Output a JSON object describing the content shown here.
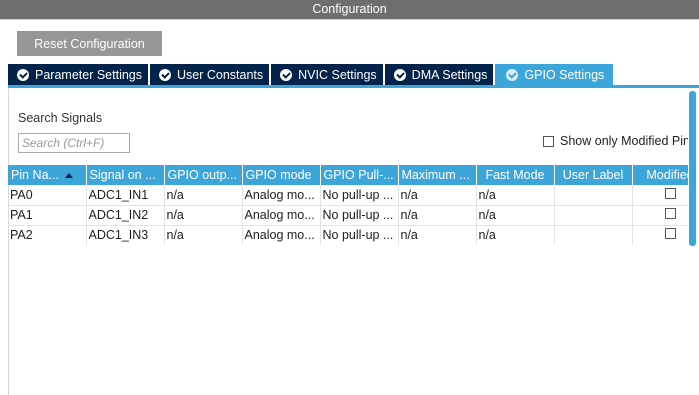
{
  "window": {
    "title": "Configuration"
  },
  "toolbar": {
    "reset_label": "Reset Configuration"
  },
  "tabs": [
    {
      "label": "Parameter Settings",
      "icon": "check-circle-icon",
      "active": false
    },
    {
      "label": "User Constants",
      "icon": "check-circle-icon",
      "active": false
    },
    {
      "label": "NVIC Settings",
      "icon": "check-circle-icon",
      "active": false
    },
    {
      "label": "DMA Settings",
      "icon": "check-circle-icon",
      "active": false
    },
    {
      "label": "GPIO Settings",
      "icon": "check-circle-icon",
      "active": true
    }
  ],
  "search": {
    "label": "Search Signals",
    "placeholder": "Search (Ctrl+F)",
    "value": ""
  },
  "filter": {
    "label": "Show only Modified Pins",
    "checked": false
  },
  "table": {
    "columns": [
      "Pin Na...",
      "Signal on ...",
      "GPIO outp...",
      "GPIO mode",
      "GPIO Pull-...",
      "Maximum ...",
      "Fast Mode",
      "User Label",
      "Modified"
    ],
    "rows": [
      {
        "pin": "PA0",
        "signal": "ADC1_IN1",
        "output": "n/a",
        "mode": "Analog mo...",
        "pull": "No pull-up ...",
        "max": "n/a",
        "fast": "n/a",
        "label": "",
        "modified": false
      },
      {
        "pin": "PA1",
        "signal": "ADC1_IN2",
        "output": "n/a",
        "mode": "Analog mo...",
        "pull": "No pull-up ...",
        "max": "n/a",
        "fast": "n/a",
        "label": "",
        "modified": false
      },
      {
        "pin": "PA2",
        "signal": "ADC1_IN3",
        "output": "n/a",
        "mode": "Analog mo...",
        "pull": "No pull-up ...",
        "max": "n/a",
        "fast": "n/a",
        "label": "",
        "modified": false
      }
    ]
  },
  "colors": {
    "title_bar": "#6e6e6e",
    "tab_inactive": "#03234b",
    "accent": "#3ca6db",
    "button": "#969696"
  }
}
